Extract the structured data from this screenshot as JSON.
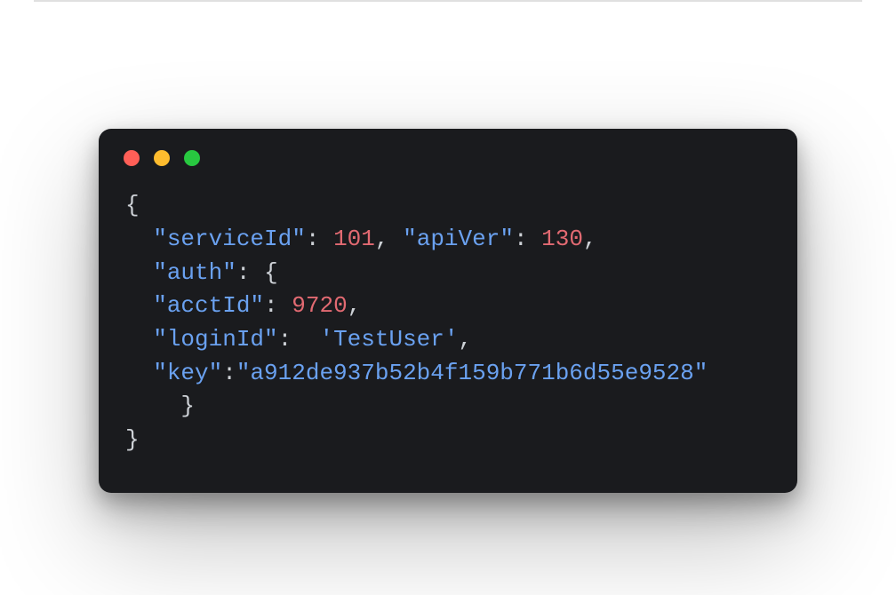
{
  "window": {
    "dots": [
      "red",
      "yellow",
      "green"
    ]
  },
  "code": {
    "line1": {
      "brace_open": "{"
    },
    "line2": {
      "indent": "  ",
      "key1": "\"serviceId\"",
      "colon1": ": ",
      "val1": "101",
      "comma1": ", ",
      "key2": "\"apiVer\"",
      "colon2": ": ",
      "val2": "130",
      "comma2": ","
    },
    "line3": {
      "indent": "  ",
      "key": "\"auth\"",
      "colon": ": ",
      "brace": "{"
    },
    "line4": {
      "indent": "  ",
      "key": "\"acctId\"",
      "colon": ": ",
      "val": "9720",
      "comma": ","
    },
    "line5": {
      "indent": "  ",
      "key": "\"loginId\"",
      "colon": ":  ",
      "val": "'TestUser'",
      "comma": ","
    },
    "line6": {
      "indent": "  ",
      "key": "\"key\"",
      "colon": ":",
      "val": "\"a912de937b52b4f159b771b6d55e9528\""
    },
    "line7": {
      "indent": "    ",
      "brace_close": "}"
    },
    "line8": {
      "brace_close": "}"
    }
  }
}
